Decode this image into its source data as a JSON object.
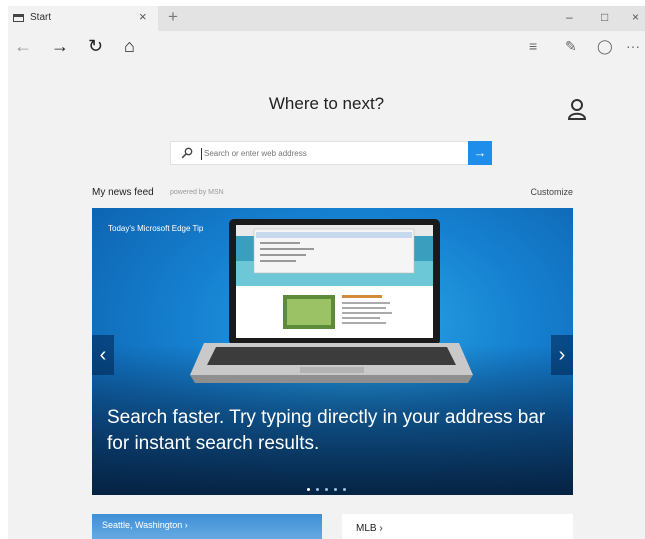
{
  "tab": {
    "title": "Start",
    "close": "×",
    "new_tab": "+"
  },
  "window_controls": {
    "minimize": "–",
    "maximize": "□",
    "close": "×"
  },
  "nav": {
    "back": "←",
    "forward": "→",
    "refresh": "↻",
    "home": "⌂"
  },
  "toolbar_right": {
    "reading": "≡",
    "notes": "✎",
    "share": "◯",
    "more": "···"
  },
  "headline": "Where to next?",
  "search": {
    "placeholder": "Search or enter web address",
    "go": "→"
  },
  "feed": {
    "title": "My news feed",
    "powered_by": "powered by MSN",
    "customize": "Customize"
  },
  "hero": {
    "tip_label": "Today's Microsoft Edge Tip",
    "text": "Search faster. Try typing directly in your address bar for instant search results.",
    "prev": "‹",
    "next": "›",
    "slide_count": 5,
    "active_slide": 1
  },
  "cards": {
    "weather": "Seattle, Washington  ›",
    "mlb": "MLB ›"
  },
  "colors": {
    "accent": "#1f8dea",
    "hero_blue": "#1680d0",
    "chrome": "#f2f2f2"
  }
}
